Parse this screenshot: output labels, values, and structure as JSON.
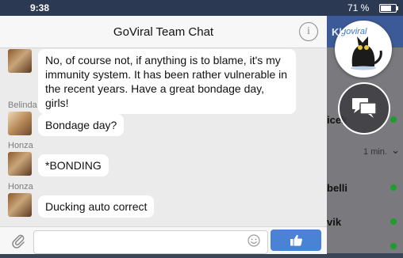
{
  "status_bar": {
    "time": "9:38",
    "battery_percent": "71 %",
    "battery_level": 0.71
  },
  "background": {
    "tab_label": "Kl",
    "rows": [
      {
        "name": "icek",
        "online": true
      },
      {
        "meta": "1 min."
      },
      {
        "name": "belli",
        "online": true
      },
      {
        "name": "vik",
        "online": true
      },
      {
        "online": true
      }
    ]
  },
  "chat": {
    "title": "GoViral Team Chat",
    "info_icon": "info-icon",
    "messages": [
      {
        "sender": "",
        "text": "No, of course not, if anything is to blame, it's my immunity system. It has been rather vulnerable in the recent years. Have a great bondage day, girls!"
      },
      {
        "sender": "Belinda",
        "text": "Bondage day?"
      },
      {
        "sender": "Honza",
        "text": "*BONDING"
      },
      {
        "sender": "Honza",
        "text": "Ducking auto correct"
      }
    ],
    "composer": {
      "placeholder": "",
      "attach_icon": "paperclip-icon",
      "emoji_icon": "smiley-icon",
      "send_icon": "thumbs-up-icon"
    }
  },
  "floating": {
    "brand_logo": "goviral",
    "head_icon": "chat-bubbles-icon"
  },
  "colors": {
    "status_bar": "#2b3a52",
    "header_blue": "#3d5a98",
    "like_button": "#4a82d6",
    "online_dot": "#1f9c2e"
  }
}
